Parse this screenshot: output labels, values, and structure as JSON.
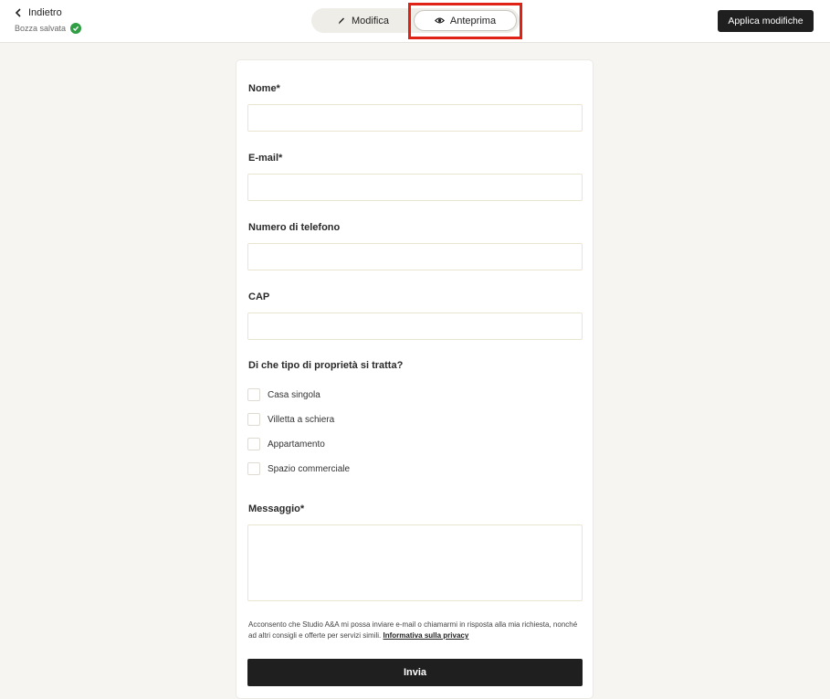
{
  "header": {
    "back_label": "Indietro",
    "draft_status": "Bozza salvata",
    "toggle": {
      "edit_label": "Modifica",
      "preview_label": "Anteprima",
      "selected": "preview"
    },
    "apply_label": "Applica modifiche"
  },
  "form": {
    "fields": [
      {
        "label": "Nome*",
        "value": "",
        "placeholder": ""
      },
      {
        "label": "E-mail*",
        "value": "",
        "placeholder": ""
      },
      {
        "label": "Numero di telefono",
        "value": "",
        "placeholder": ""
      },
      {
        "label": "CAP",
        "value": "",
        "placeholder": ""
      }
    ],
    "property_question": "Di che tipo di proprietà si tratta?",
    "property_options": [
      {
        "label": "Casa singola",
        "checked": false
      },
      {
        "label": "Villetta a schiera",
        "checked": false
      },
      {
        "label": "Appartamento",
        "checked": false
      },
      {
        "label": "Spazio commerciale",
        "checked": false
      }
    ],
    "message_label": "Messaggio*",
    "message_value": "",
    "consent_text": "Acconsento che Studio A&A mi possa inviare e-mail o chiamarmi in risposta alla mia richiesta, nonché ad altri consigli e offerte per servizi simili.",
    "privacy_link": "Informativa sulla privacy",
    "submit_label": "Invia"
  },
  "colors": {
    "background": "#f6f5f2",
    "primary_button": "#1f1f1f",
    "saved_check": "#2f9e44",
    "highlight": "#e02216"
  }
}
